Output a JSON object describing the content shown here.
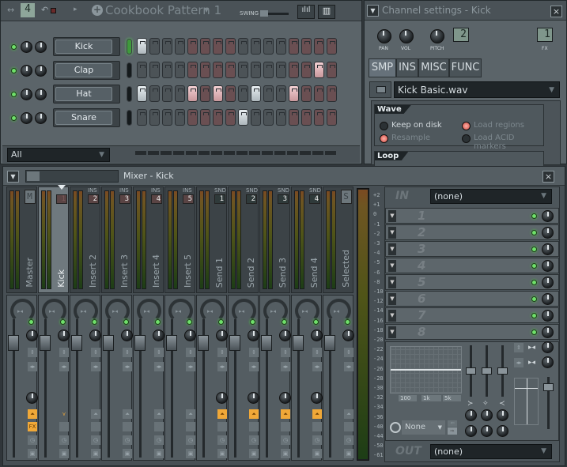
{
  "step_sequencer": {
    "pattern_number": "4",
    "pattern_name": "Cookbook Pattern 1",
    "swing_label": "SWING",
    "filter": "All",
    "channels": [
      {
        "name": "Kick",
        "selected": true,
        "steps": [
          1,
          0,
          0,
          0,
          0,
          0,
          0,
          0,
          0,
          0,
          0,
          0,
          0,
          0,
          0,
          0
        ]
      },
      {
        "name": "Clap",
        "selected": false,
        "steps": [
          0,
          0,
          0,
          0,
          0,
          0,
          0,
          0,
          0,
          0,
          0,
          0,
          0,
          0,
          1,
          0
        ]
      },
      {
        "name": "Hat",
        "selected": false,
        "steps": [
          1,
          0,
          0,
          0,
          1,
          0,
          1,
          0,
          0,
          1,
          0,
          0,
          1,
          0,
          0,
          0
        ]
      },
      {
        "name": "Snare",
        "selected": false,
        "steps": [
          0,
          0,
          0,
          0,
          0,
          0,
          0,
          0,
          1,
          0,
          0,
          0,
          0,
          0,
          0,
          0
        ]
      }
    ]
  },
  "channel_settings": {
    "title": "Channel settings - Kick",
    "knob_labels": {
      "pan": "PAN",
      "vol": "VOL",
      "pitch": "PITCH",
      "fx": "FX"
    },
    "pitch_value": "2",
    "fx_value": "1",
    "tabs": [
      "SMP",
      "INS",
      "MISC",
      "FUNC"
    ],
    "active_tab": "SMP",
    "sample_file": "Kick Basic.wav",
    "wave_section": "Wave",
    "options": [
      {
        "label": "Keep on disk",
        "on": false,
        "enabled": true
      },
      {
        "label": "Load regions",
        "on": true,
        "enabled": false
      },
      {
        "label": "Resample",
        "on": true,
        "enabled": false
      },
      {
        "label": "Load ACID markers",
        "on": false,
        "enabled": false
      }
    ],
    "loop_section": "Loop"
  },
  "mixer": {
    "title": "Mixer - Kick",
    "tracks": [
      {
        "name": "Master",
        "tag": "",
        "num": "M",
        "type": "master"
      },
      {
        "name": "Kick",
        "tag": "",
        "num": "1",
        "type": "ins",
        "selected": true
      },
      {
        "name": "Insert 2",
        "tag": "INS",
        "num": "2",
        "type": "ins"
      },
      {
        "name": "Insert 3",
        "tag": "INS",
        "num": "3",
        "type": "ins"
      },
      {
        "name": "Insert 4",
        "tag": "INS",
        "num": "4",
        "type": "ins"
      },
      {
        "name": "Insert 5",
        "tag": "INS",
        "num": "5",
        "type": "ins"
      },
      {
        "name": "Send 1",
        "tag": "SND",
        "num": "1",
        "type": "snd"
      },
      {
        "name": "Send 2",
        "tag": "SND",
        "num": "2",
        "type": "snd"
      },
      {
        "name": "Send 3",
        "tag": "SND",
        "num": "3",
        "type": "snd"
      },
      {
        "name": "Send 4",
        "tag": "SND",
        "num": "4",
        "type": "snd"
      },
      {
        "name": "Selected",
        "tag": "",
        "num": "S",
        "type": "sel"
      }
    ],
    "fx_label": "FX",
    "meter_scale": [
      "+2",
      "+1",
      "0",
      "-1",
      "-2",
      "-3",
      "-4",
      "-5",
      "-6",
      "-8",
      "-10",
      "-12",
      "-14",
      "-16",
      "-18",
      "-20",
      "-22",
      "-24",
      "-26",
      "-28",
      "-30",
      "-32",
      "-34",
      "-36",
      "-40",
      "-44",
      "-50",
      "-61"
    ],
    "in_label": "IN",
    "in_value": "(none)",
    "slots": [
      "1",
      "2",
      "3",
      "4",
      "5",
      "6",
      "7",
      "8"
    ],
    "eq_freqs": [
      "100",
      "1k",
      "5k"
    ],
    "tempo_sync": "None",
    "out_label": "OUT",
    "out_value": "(none)"
  }
}
